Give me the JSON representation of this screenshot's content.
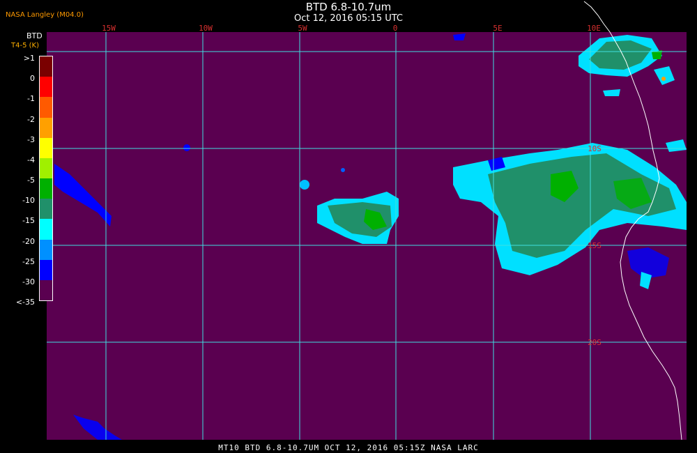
{
  "header": {
    "credit": "NASA Langley (M04.0)",
    "title": "BTD 6.8-10.7um",
    "subtitle": "Oct 12, 2016 05:15 UTC"
  },
  "legend": {
    "title": "BTD",
    "units": "T4-5 (K)",
    "labels": [
      ">1",
      "0",
      "-1",
      "-2",
      "-3",
      "-4",
      "-5",
      "-10",
      "-15",
      "-20",
      "-25",
      "-30",
      "<-35"
    ],
    "colors": [
      "#7a0000",
      "#ff0000",
      "#ff5a00",
      "#ffa000",
      "#ffff00",
      "#a0f000",
      "#00b000",
      "#20906a",
      "#00ffff",
      "#0090ff",
      "#0000ff",
      "#5a0050"
    ]
  },
  "grid": {
    "longitude_labels": [
      "15W",
      "10W",
      "5W",
      "0",
      "5E",
      "10E"
    ],
    "latitude_labels": [
      "10S",
      "15S",
      "20S"
    ]
  },
  "footer": {
    "text": "MT10  BTD 6.8-10.7UM   OCT 12, 2016 05:15Z   NASA LARC"
  },
  "colors": {
    "background": "#5a0050",
    "grid": "#40e0e0",
    "coastline": "#ffffff",
    "grid_label": "#d83030"
  }
}
